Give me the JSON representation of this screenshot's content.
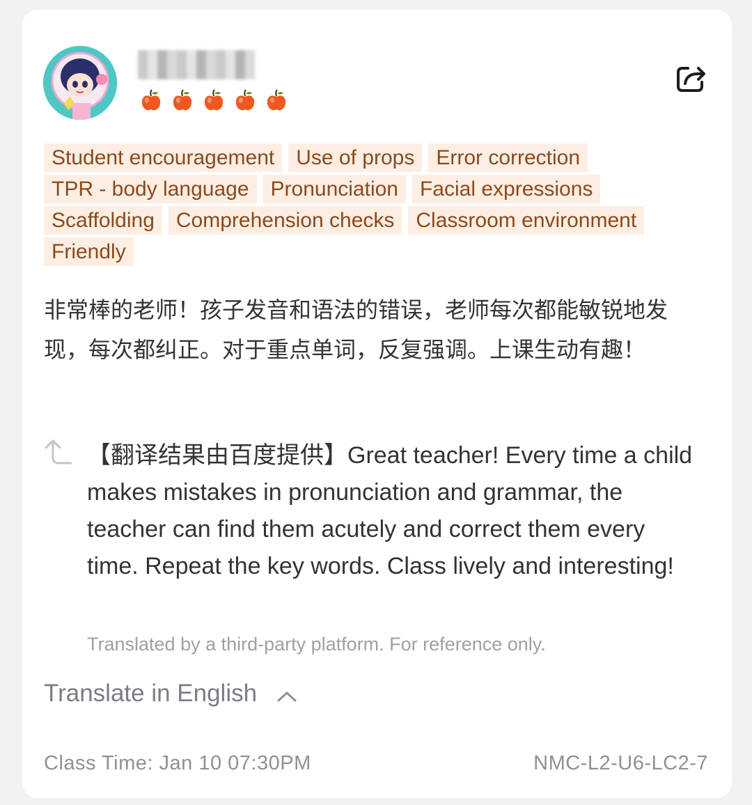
{
  "review": {
    "rating": 5,
    "tags": [
      "Student encouragement",
      "Use of props",
      "Error correction",
      "TPR - body language",
      "Pronunciation",
      "Facial expressions",
      "Scaffolding",
      "Comprehension checks",
      "Classroom environment",
      "Friendly"
    ],
    "text": "非常棒的老师！孩子发音和语法的错误，老师每次都能敏锐地发现，每次都纠正。对于重点单词，反复强调。上课生动有趣！",
    "translation": "【翻译结果由百度提供】Great teacher! Every time a child makes mistakes in pronunciation and grammar, the teacher can find them acutely and correct them every time. Repeat the key words. Class lively and interesting!",
    "disclaimer": "Translated by a third-party platform. For reference only.",
    "translate_toggle_label": "Translate in English",
    "class_time": "Class Time: Jan 10 07:30PM",
    "lesson_code": "NMC-L2-U6-LC2-7"
  },
  "icons": {
    "avatar": "astronaut-girl-avatar",
    "rating": "apple-icon",
    "share": "share-icon",
    "reply": "reply-arrow-icon",
    "toggle": "chevron-up-icon"
  },
  "colors": {
    "tag_background": "#fdeee3",
    "tag_text": "#8a4a1c",
    "apple": "#f0581f",
    "avatar_background": "#4fc7c4"
  }
}
